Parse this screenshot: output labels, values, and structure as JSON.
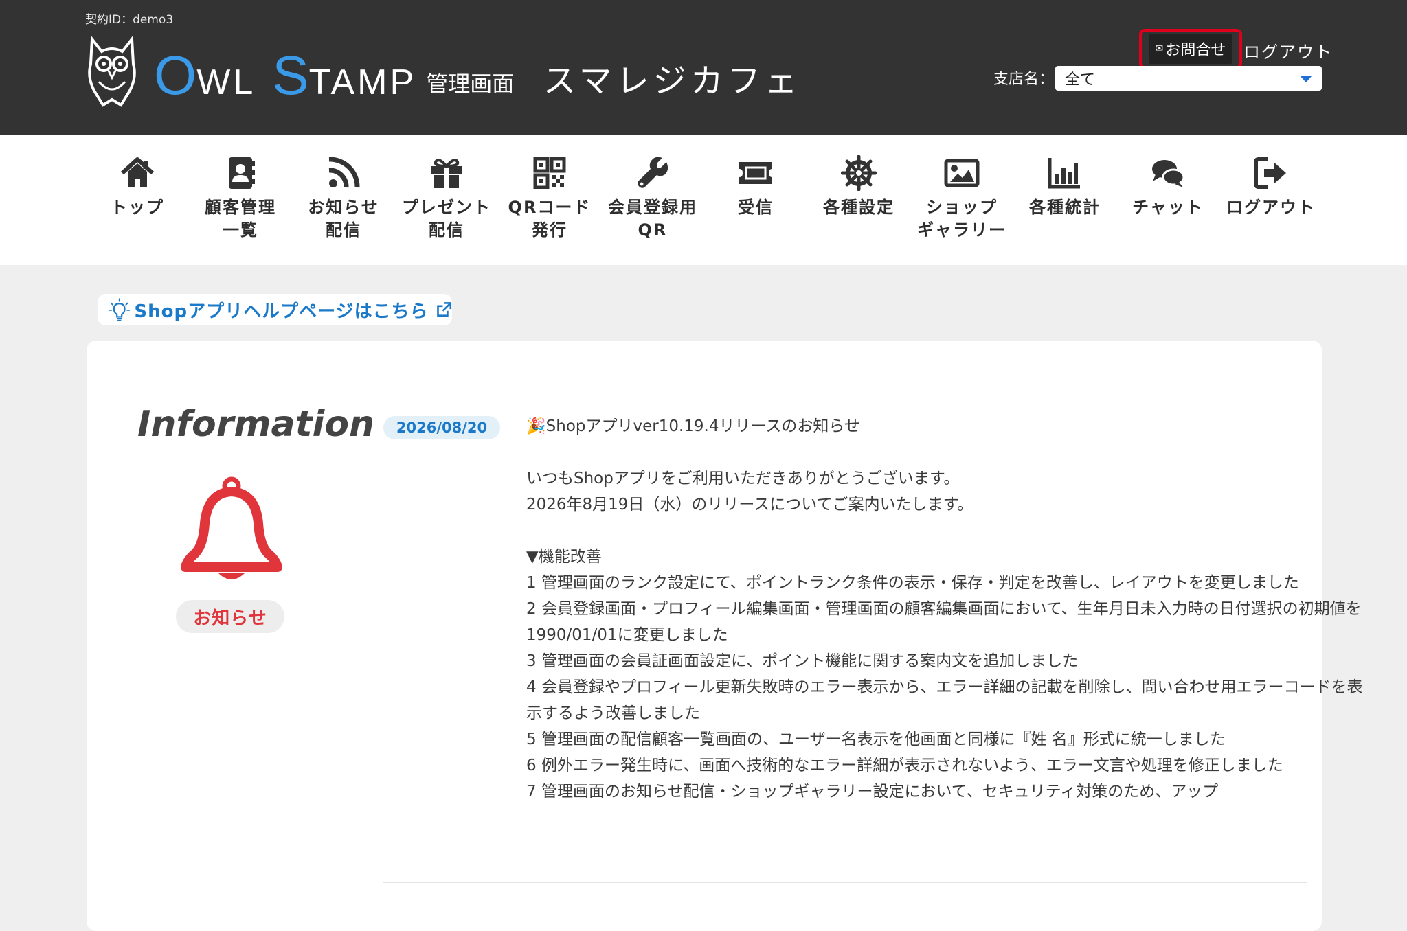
{
  "header": {
    "contract_id": "契約ID：demo3",
    "logo": {
      "o": "O",
      "wl": "WL",
      "s": "S",
      "tamp": "TAMP",
      "admin": "管理画面"
    },
    "shop_name": "スマレジカフェ",
    "contact_label": "お問合せ",
    "logout_label": "ログアウト",
    "branch_label": "支店名：",
    "branch_selected": "全て"
  },
  "nav": [
    {
      "label": "トップ",
      "icon": "home-icon"
    },
    {
      "label": "顧客管理\n一覧",
      "icon": "contacts-icon"
    },
    {
      "label": "お知らせ\n配信",
      "icon": "rss-icon"
    },
    {
      "label": "プレゼント\n配信",
      "icon": "gift-icon"
    },
    {
      "label": "QRコード\n発行",
      "icon": "qrcode-icon"
    },
    {
      "label": "会員登録用\nQR",
      "icon": "wrench-icon"
    },
    {
      "label": "受信",
      "icon": "ticket-icon"
    },
    {
      "label": "各種設定",
      "icon": "helm-icon"
    },
    {
      "label": "ショップ\nギャラリー",
      "icon": "image-icon"
    },
    {
      "label": "各種統計",
      "icon": "bar-chart-icon"
    },
    {
      "label": "チャット",
      "icon": "chat-icon"
    },
    {
      "label": "ログアウト",
      "icon": "sign-out-icon"
    }
  ],
  "help_link": "Shopアプリヘルプページはこちら",
  "info": {
    "title": "Information",
    "badge": "お知らせ",
    "date": "2026/08/20",
    "news_title": "🎉Shopアプリver10.19.4リリースのお知らせ",
    "greeting_1": "いつもShopアプリをご利用いただきありがとうございます。",
    "greeting_2": "2026年8月19日（水）のリリースについてご案内いたします。",
    "section": "▼機能改善",
    "items": [
      "1 管理画面のランク設定にて、ポイントランク条件の表示・保存・判定を改善し、レイアウトを変更しました",
      "2 会員登録画面・プロフィール編集画面・管理画面の顧客編集画面において、生年月日未入力時の日付選択の初期値を1990/01/01に変更しました",
      "3 管理画面の会員証画面設定に、ポイント機能に関する案内文を追加しました",
      "4 会員登録やプロフィール更新失敗時のエラー表示から、エラー詳細の記載を削除し、問い合わせ用エラーコードを表示するよう改善しました",
      "5 管理画面の配信顧客一覧画面の、ユーザー名表示を他画面と同様に『姓 名』形式に統一しました",
      "6 例外エラー発生時に、画面へ技術的なエラー詳細が表示されないよう、エラー文言や処理を修正しました",
      "7 管理画面のお知らせ配信・ショップギャラリー設定において、セキュリティ対策のため、アップ"
    ]
  }
}
